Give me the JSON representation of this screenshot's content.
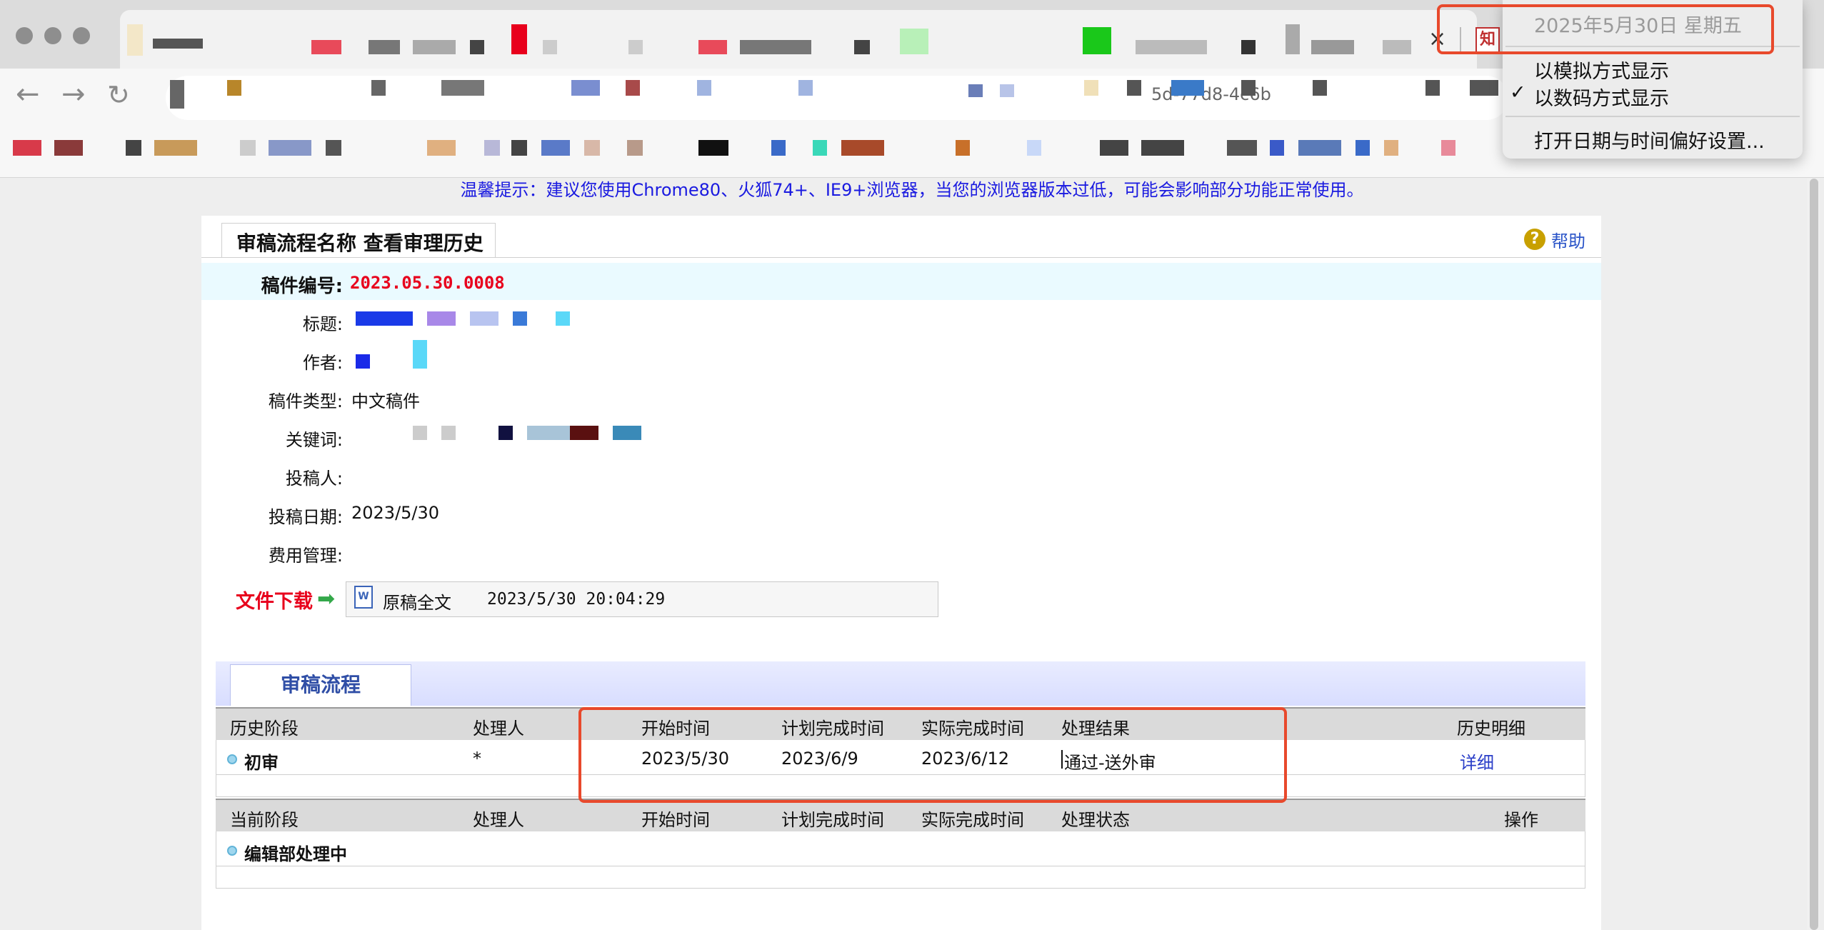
{
  "browser": {
    "tab_close": "×",
    "tab_favicon_text": "知",
    "nav": {
      "back": "←",
      "forward": "→",
      "reload": "↻"
    },
    "address_fragment": "5d-77d8-4c6b"
  },
  "clock_menu": {
    "date_text": "2025年5月30日 星期五",
    "items": [
      "以模拟方式显示",
      "以数码方式显示",
      "打开日期与时间偏好设置..."
    ],
    "checked_mark": "✓",
    "checked_item": "以数码方式显示"
  },
  "page": {
    "warning": "温馨提示：建议您使用Chrome80、火狐74+、IE9+浏览器，当您的浏览器版本过低，可能会影响部分功能正常使用。",
    "tab_title": "审稿流程名称 查看审理历史",
    "help_label": "帮助",
    "help_icon_char": "?",
    "fields": {
      "manuscript_no_label": "稿件编号:",
      "manuscript_no_value": "2023.05.30.0008",
      "title_label": "标题:",
      "author_label": "作者:",
      "type_label": "稿件类型:",
      "type_value": "中文稿件",
      "keywords_label": "关键词:",
      "submitter_label": "投稿人:",
      "date_label": "投稿日期:",
      "date_value": "2023/5/30",
      "fee_label": "费用管理:"
    },
    "download": {
      "label": "文件下载",
      "arrow": "➡",
      "doc_icon_char": "W",
      "file_name": "原稿全文",
      "file_time": "2023/5/30 20:04:29"
    }
  },
  "workflow": {
    "tab_label": "审稿流程",
    "history_headers": [
      "历史阶段",
      "处理人",
      "开始时间",
      "计划完成时间",
      "实际完成时间",
      "处理结果",
      "历史明细"
    ],
    "history_rows": [
      {
        "stage": "初审",
        "handler": "*",
        "start": "2023/5/30",
        "planned": "2023/6/9",
        "actual": "2023/6/12",
        "result": "通过-送外审",
        "detail": "详细"
      }
    ],
    "current_headers": [
      "当前阶段",
      "处理人",
      "开始时间",
      "计划完成时间",
      "实际完成时间",
      "处理状态",
      "操作"
    ],
    "current_rows": [
      {
        "stage": "编辑部处理中"
      }
    ]
  },
  "colors": {
    "highlight": "#e8492c",
    "warning_text": "#1a1ae0",
    "manuscript_no": "#e8001c",
    "link": "#2a3ec8"
  }
}
